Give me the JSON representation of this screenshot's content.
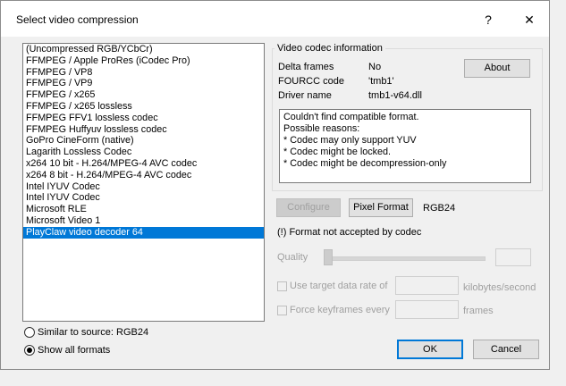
{
  "window": {
    "title": "Select video compression",
    "help_glyph": "?",
    "close_glyph": "✕"
  },
  "codec_list": {
    "items": [
      "(Uncompressed RGB/YCbCr)",
      "FFMPEG / Apple ProRes (iCodec Pro)",
      "FFMPEG / VP8",
      "FFMPEG / VP9",
      "FFMPEG / x265",
      "FFMPEG / x265 lossless",
      "FFMPEG FFV1 lossless codec",
      "FFMPEG Huffyuv lossless codec",
      "GoPro CineForm (native)",
      "Lagarith Lossless Codec",
      "x264 10 bit - H.264/MPEG-4 AVC codec",
      "x264 8 bit - H.264/MPEG-4 AVC codec",
      "Intel IYUV Codec",
      "Intel IYUV Codec",
      "Microsoft RLE",
      "Microsoft Video 1",
      "PlayClaw video decoder 64"
    ],
    "selected_index": 16
  },
  "info": {
    "group_label": "Video codec information",
    "delta_frames_label": "Delta frames",
    "delta_frames_value": "No",
    "fourcc_label": "FOURCC code",
    "fourcc_value": "'tmb1'",
    "driver_label": "Driver name",
    "driver_value": "tmb1-v64.dll",
    "about_label": "About",
    "message_lines": [
      "Couldn't find compatible format.",
      "Possible reasons:",
      "*  Codec may only support YUV",
      "*  Codec might be locked.",
      "*  Codec might be decompression-only"
    ]
  },
  "format": {
    "configure_label": "Configure",
    "pixel_format_label": "Pixel Format",
    "pixel_format_value": "RGB24",
    "warning": "(!) Format not accepted by codec"
  },
  "quality": {
    "label": "Quality"
  },
  "data_rate": {
    "label": "Use target data rate of",
    "unit": "kilobytes/second"
  },
  "keyframes": {
    "label": "Force keyframes every",
    "unit": "frames"
  },
  "source": {
    "similar_label": "Similar to source: RGB24",
    "show_all_label": "Show all formats",
    "selected": "show_all"
  },
  "actions": {
    "ok_label": "OK",
    "cancel_label": "Cancel"
  }
}
